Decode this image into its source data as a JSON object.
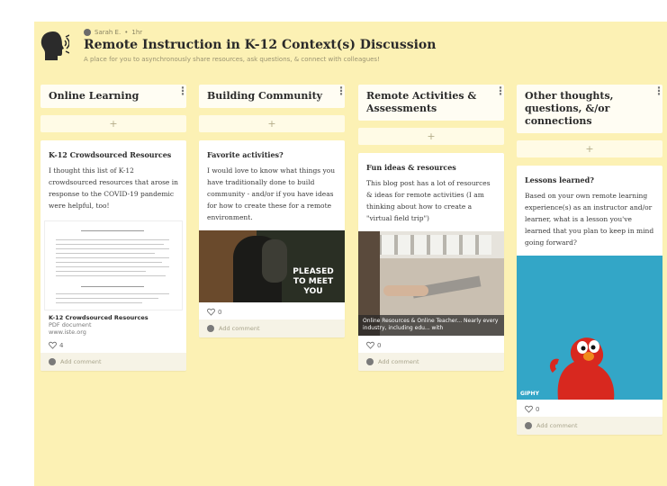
{
  "header": {
    "author": "Sarah E.",
    "time": "1hr",
    "title": "Remote Instruction in K-12 Context(s) Discussion",
    "subtitle": "A place for you to asynchronously share resources, ask questions, & connect with colleagues!"
  },
  "add_symbol": "+",
  "columns": [
    {
      "title": "Online Learning",
      "card": {
        "title": "K-12 Crowdsourced Resources",
        "body": "I thought this list of K-12 crowdsourced resources that arose in response to the COVID-19 pandemic were helpful, too!",
        "attachment_title": "K-12 Crowdsourced Resources",
        "attachment_type": "PDF document",
        "attachment_source": "www.iste.org",
        "likes": "4",
        "comment_placeholder": "Add comment"
      }
    },
    {
      "title": "Building Community",
      "card": {
        "title": "Favorite activities?",
        "body": "I would love to know what things you have traditionally done to build community - and/or if you have ideas for how to create these for a remote environment.",
        "image_text": "PLEASED TO MEET YOU",
        "likes": "0",
        "comment_placeholder": "Add comment"
      }
    },
    {
      "title": "Remote Activities & Assessments",
      "card": {
        "title": "Fun ideas & resources",
        "body": "This blog post has a lot of resources & ideas for remote activities (I am thinking about how to create a \"virtual field trip\")",
        "link_caption": "Online Resources & Online Teacher... Nearly every industry, including edu... with",
        "likes": "0",
        "comment_placeholder": "Add comment"
      }
    },
    {
      "title": "Other thoughts, questions, &/or connections",
      "card": {
        "title": "Lessons learned?",
        "body": "Based on your own remote learning experience(s) as an instructor and/or learner, what is a lesson you've learned that you plan to keep in mind going forward?",
        "gif_label": "GIPHY",
        "likes": "0",
        "comment_placeholder": "Add comment"
      }
    }
  ],
  "colors": {
    "board_bg": "#fcf1b4",
    "card_bg": "#ffffff",
    "text": "#2a2a2a",
    "elmo_red": "#d8281f",
    "elmo_bg": "#33a6c7"
  },
  "icons": [
    "speaker-avatar-icon",
    "kebab-menu-icon",
    "heart-icon",
    "add-icon",
    "user-avatar-icon"
  ]
}
